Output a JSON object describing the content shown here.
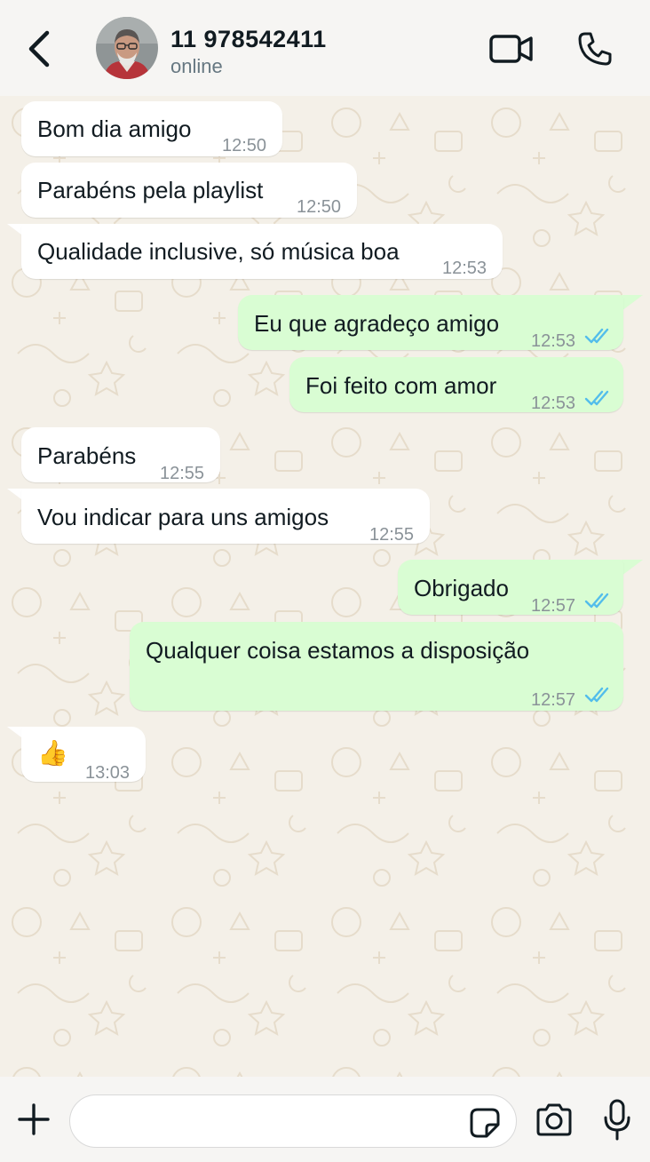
{
  "header": {
    "contact_name": "11 978542411",
    "status": "online",
    "back_icon": "chevron-left-icon",
    "video_icon": "video-camera-icon",
    "call_icon": "phone-icon"
  },
  "messages": [
    {
      "direction": "in",
      "text": "Bom dia amigo",
      "time": "12:50"
    },
    {
      "direction": "in",
      "text": "Parabéns pela playlist",
      "time": "12:50"
    },
    {
      "direction": "in",
      "text": "Qualidade inclusive, só música boa",
      "time": "12:53"
    },
    {
      "direction": "out",
      "text": "Eu que agradeço amigo",
      "time": "12:53",
      "read": true
    },
    {
      "direction": "out",
      "text": "Foi feito com amor",
      "time": "12:53",
      "read": true
    },
    {
      "direction": "in",
      "text": "Parabéns",
      "time": "12:55"
    },
    {
      "direction": "in",
      "text": "Vou indicar para uns amigos",
      "time": "12:55"
    },
    {
      "direction": "out",
      "text": "Obrigado",
      "time": "12:57",
      "read": true
    },
    {
      "direction": "out",
      "text": "Qualquer coisa estamos a disposição",
      "time": "12:57",
      "read": true
    },
    {
      "direction": "in",
      "text": "👍",
      "time": "13:03"
    }
  ],
  "composer": {
    "placeholder": "",
    "value": ""
  },
  "colors": {
    "header_bg": "#f6f5f3",
    "chat_bg": "#f4f0e8",
    "incoming_bubble": "#ffffff",
    "outgoing_bubble": "#d9fdd3",
    "read_ticks": "#53bdeb",
    "timestamp": "#8a9298"
  }
}
